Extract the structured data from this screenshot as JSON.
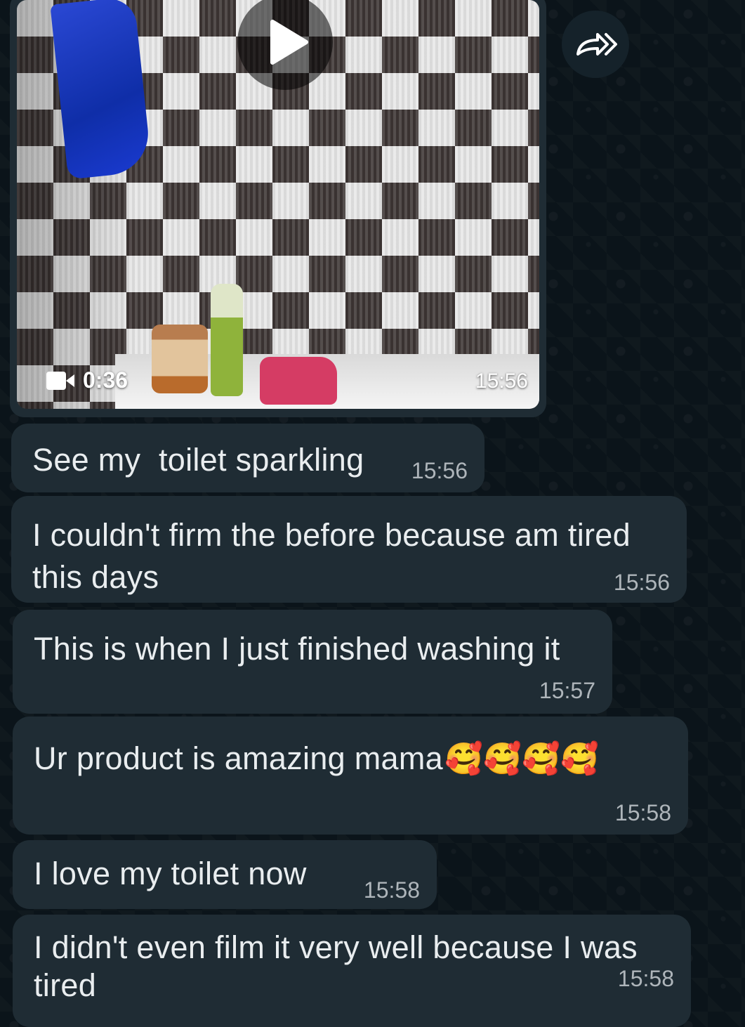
{
  "video_message": {
    "duration": "0:36",
    "time": "15:56",
    "play_icon": "play-icon",
    "camera_icon": "video-camera-icon"
  },
  "forward": {
    "icon": "forward-icon"
  },
  "messages": [
    {
      "text": "See my  toilet sparkling",
      "time": "15:56"
    },
    {
      "text": "I couldn't firm the before because am tired this days",
      "time": "15:56"
    },
    {
      "text": "This is when I just finished washing it",
      "time": "15:57"
    },
    {
      "text": "Ur product is amazing mama",
      "emojis": "🥰🥰🥰🥰",
      "time": "15:58"
    },
    {
      "text": "I love my toilet now",
      "time": "15:58"
    },
    {
      "text": "I didn't even film it very well because I was tired",
      "time": "15:58"
    }
  ],
  "colors": {
    "background": "#0b141a",
    "bubble": "#1f2c34",
    "text": "#e9edef",
    "timestamp": "#aeb5ba"
  }
}
